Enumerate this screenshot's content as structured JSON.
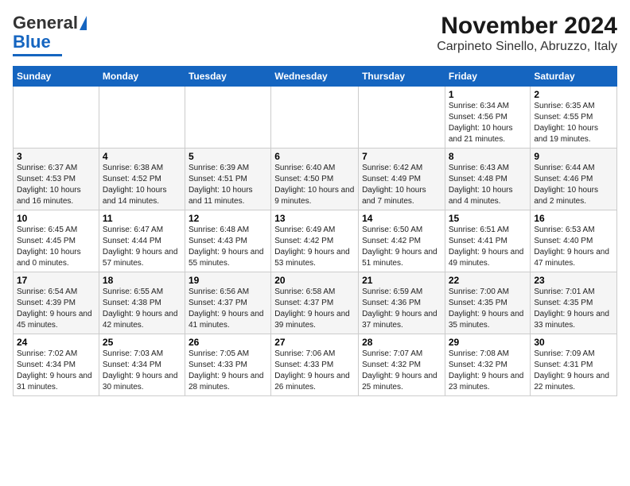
{
  "logo": {
    "line1": "General",
    "line2": "Blue"
  },
  "title": "November 2024",
  "subtitle": "Carpineto Sinello, Abruzzo, Italy",
  "days_of_week": [
    "Sunday",
    "Monday",
    "Tuesday",
    "Wednesday",
    "Thursday",
    "Friday",
    "Saturday"
  ],
  "weeks": [
    [
      {
        "day": "",
        "info": ""
      },
      {
        "day": "",
        "info": ""
      },
      {
        "day": "",
        "info": ""
      },
      {
        "day": "",
        "info": ""
      },
      {
        "day": "",
        "info": ""
      },
      {
        "day": "1",
        "info": "Sunrise: 6:34 AM\nSunset: 4:56 PM\nDaylight: 10 hours and 21 minutes."
      },
      {
        "day": "2",
        "info": "Sunrise: 6:35 AM\nSunset: 4:55 PM\nDaylight: 10 hours and 19 minutes."
      }
    ],
    [
      {
        "day": "3",
        "info": "Sunrise: 6:37 AM\nSunset: 4:53 PM\nDaylight: 10 hours and 16 minutes."
      },
      {
        "day": "4",
        "info": "Sunrise: 6:38 AM\nSunset: 4:52 PM\nDaylight: 10 hours and 14 minutes."
      },
      {
        "day": "5",
        "info": "Sunrise: 6:39 AM\nSunset: 4:51 PM\nDaylight: 10 hours and 11 minutes."
      },
      {
        "day": "6",
        "info": "Sunrise: 6:40 AM\nSunset: 4:50 PM\nDaylight: 10 hours and 9 minutes."
      },
      {
        "day": "7",
        "info": "Sunrise: 6:42 AM\nSunset: 4:49 PM\nDaylight: 10 hours and 7 minutes."
      },
      {
        "day": "8",
        "info": "Sunrise: 6:43 AM\nSunset: 4:48 PM\nDaylight: 10 hours and 4 minutes."
      },
      {
        "day": "9",
        "info": "Sunrise: 6:44 AM\nSunset: 4:46 PM\nDaylight: 10 hours and 2 minutes."
      }
    ],
    [
      {
        "day": "10",
        "info": "Sunrise: 6:45 AM\nSunset: 4:45 PM\nDaylight: 10 hours and 0 minutes."
      },
      {
        "day": "11",
        "info": "Sunrise: 6:47 AM\nSunset: 4:44 PM\nDaylight: 9 hours and 57 minutes."
      },
      {
        "day": "12",
        "info": "Sunrise: 6:48 AM\nSunset: 4:43 PM\nDaylight: 9 hours and 55 minutes."
      },
      {
        "day": "13",
        "info": "Sunrise: 6:49 AM\nSunset: 4:42 PM\nDaylight: 9 hours and 53 minutes."
      },
      {
        "day": "14",
        "info": "Sunrise: 6:50 AM\nSunset: 4:42 PM\nDaylight: 9 hours and 51 minutes."
      },
      {
        "day": "15",
        "info": "Sunrise: 6:51 AM\nSunset: 4:41 PM\nDaylight: 9 hours and 49 minutes."
      },
      {
        "day": "16",
        "info": "Sunrise: 6:53 AM\nSunset: 4:40 PM\nDaylight: 9 hours and 47 minutes."
      }
    ],
    [
      {
        "day": "17",
        "info": "Sunrise: 6:54 AM\nSunset: 4:39 PM\nDaylight: 9 hours and 45 minutes."
      },
      {
        "day": "18",
        "info": "Sunrise: 6:55 AM\nSunset: 4:38 PM\nDaylight: 9 hours and 42 minutes."
      },
      {
        "day": "19",
        "info": "Sunrise: 6:56 AM\nSunset: 4:37 PM\nDaylight: 9 hours and 41 minutes."
      },
      {
        "day": "20",
        "info": "Sunrise: 6:58 AM\nSunset: 4:37 PM\nDaylight: 9 hours and 39 minutes."
      },
      {
        "day": "21",
        "info": "Sunrise: 6:59 AM\nSunset: 4:36 PM\nDaylight: 9 hours and 37 minutes."
      },
      {
        "day": "22",
        "info": "Sunrise: 7:00 AM\nSunset: 4:35 PM\nDaylight: 9 hours and 35 minutes."
      },
      {
        "day": "23",
        "info": "Sunrise: 7:01 AM\nSunset: 4:35 PM\nDaylight: 9 hours and 33 minutes."
      }
    ],
    [
      {
        "day": "24",
        "info": "Sunrise: 7:02 AM\nSunset: 4:34 PM\nDaylight: 9 hours and 31 minutes."
      },
      {
        "day": "25",
        "info": "Sunrise: 7:03 AM\nSunset: 4:34 PM\nDaylight: 9 hours and 30 minutes."
      },
      {
        "day": "26",
        "info": "Sunrise: 7:05 AM\nSunset: 4:33 PM\nDaylight: 9 hours and 28 minutes."
      },
      {
        "day": "27",
        "info": "Sunrise: 7:06 AM\nSunset: 4:33 PM\nDaylight: 9 hours and 26 minutes."
      },
      {
        "day": "28",
        "info": "Sunrise: 7:07 AM\nSunset: 4:32 PM\nDaylight: 9 hours and 25 minutes."
      },
      {
        "day": "29",
        "info": "Sunrise: 7:08 AM\nSunset: 4:32 PM\nDaylight: 9 hours and 23 minutes."
      },
      {
        "day": "30",
        "info": "Sunrise: 7:09 AM\nSunset: 4:31 PM\nDaylight: 9 hours and 22 minutes."
      }
    ]
  ]
}
